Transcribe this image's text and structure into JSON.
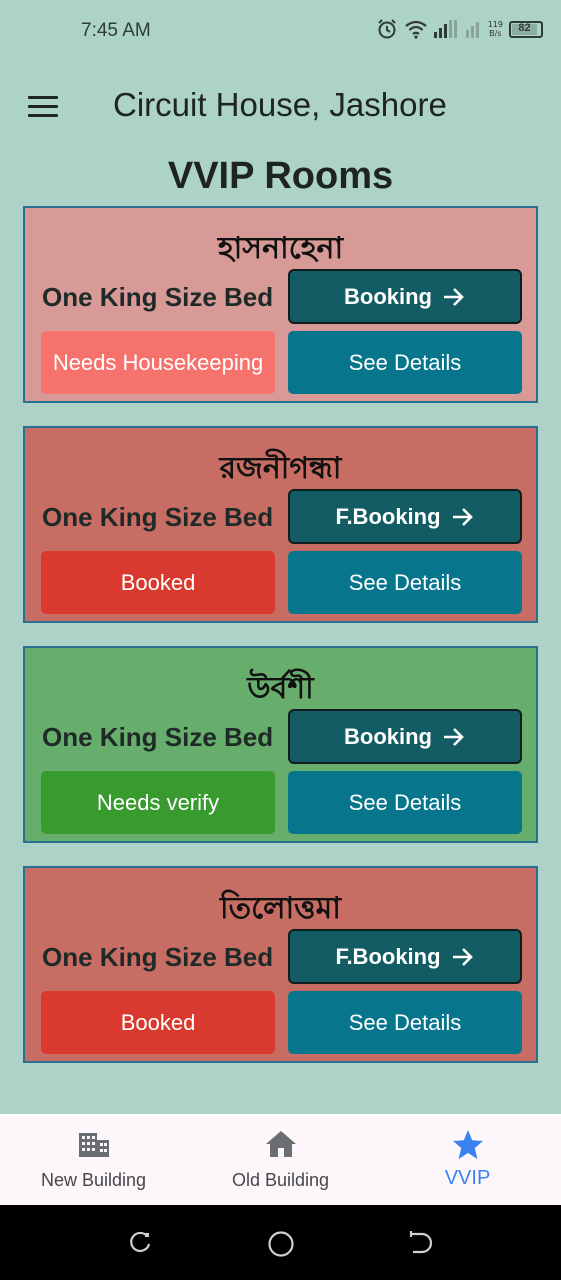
{
  "status_bar": {
    "time": "7:45 AM",
    "net_speed_value": "119",
    "net_speed_unit": "B/s",
    "battery": "82"
  },
  "app_bar": {
    "title": "Circuit House, Jashore",
    "menu_icon": "hamburger-menu-icon"
  },
  "page": {
    "title": "VVIP Rooms"
  },
  "rooms": [
    {
      "name": "হাসনাহেনা",
      "bed": "One King Size Bed",
      "booking_label": "Booking",
      "status_label": "Needs Housekeeping",
      "details_label": "See Details",
      "card_color": "#d89a97",
      "status_color": "#f6726c"
    },
    {
      "name": "রজনীগন্ধা",
      "bed": "One King Size Bed",
      "booking_label": "F.Booking",
      "status_label": "Booked",
      "details_label": "See Details",
      "card_color": "#c86d64",
      "status_color": "#d9392f"
    },
    {
      "name": "উর্বশী",
      "bed": "One King Size Bed",
      "booking_label": "Booking",
      "status_label": "Needs verify",
      "details_label": "See Details",
      "card_color": "#67ae6c",
      "status_color": "#389a2f"
    },
    {
      "name": "তিলোত্তমা",
      "bed": "One King Size Bed",
      "booking_label": "F.Booking",
      "status_label": "Booked",
      "details_label": "See Details",
      "card_color": "#c86d64",
      "status_color": "#d9392f"
    }
  ],
  "bottom_nav": {
    "items": [
      {
        "label": "New Building",
        "icon": "building-icon",
        "active": false
      },
      {
        "label": "Old Building",
        "icon": "home-icon",
        "active": false
      },
      {
        "label": "VVIP",
        "icon": "star-icon",
        "active": true
      }
    ],
    "active_color": "#3b82f0"
  },
  "colors": {
    "background": "#add3c9",
    "booking_button": "#145c63",
    "details_button": "#07758c"
  }
}
